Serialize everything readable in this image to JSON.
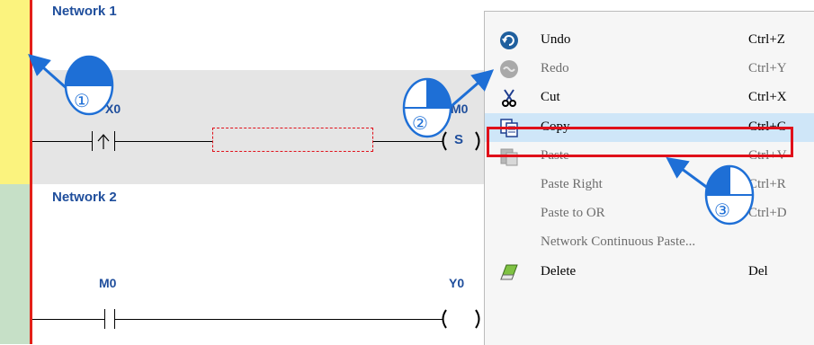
{
  "ladder": {
    "networks": [
      {
        "label": "Network 1",
        "contact": "X0",
        "coil": "M0",
        "coil_type": "S"
      },
      {
        "label": "Network 2",
        "contact": "M0",
        "coil": "Y0",
        "coil_type": ""
      }
    ]
  },
  "context_menu": {
    "items": [
      {
        "label": "Undo",
        "shortcut": "Ctrl+Z",
        "icon": "undo-icon",
        "enabled": true
      },
      {
        "label": "Redo",
        "shortcut": "Ctrl+Y",
        "icon": "redo-icon",
        "enabled": false
      },
      {
        "label": "Cut",
        "shortcut": "Ctrl+X",
        "icon": "scissors-icon",
        "enabled": true
      },
      {
        "label": "Copy",
        "shortcut": "Ctrl+C",
        "icon": "copy-icon",
        "enabled": true,
        "highlighted": true
      },
      {
        "label": "Paste",
        "shortcut": "Ctrl+V",
        "icon": "paste-icon",
        "enabled": false
      },
      {
        "label": "Paste Right",
        "shortcut": "Ctrl+R",
        "icon": "",
        "enabled": false
      },
      {
        "label": "Paste to OR",
        "shortcut": "Ctrl+D",
        "icon": "",
        "enabled": false
      },
      {
        "label": "Network Continuous Paste...",
        "shortcut": "",
        "icon": "",
        "enabled": false
      },
      {
        "label": "Delete",
        "shortcut": "Del",
        "icon": "eraser-icon",
        "enabled": true
      }
    ]
  },
  "steps": [
    {
      "number": "①"
    },
    {
      "number": "②"
    },
    {
      "number": "③"
    }
  ],
  "colors": {
    "rail": "#e32018",
    "network1_strip": "#fbf37e",
    "network2_strip": "#c6e0c7",
    "selected_band": "#e5e5e5",
    "label_blue": "#1f4e9c",
    "highlight_border": "#e0101a",
    "arrow_blue": "#1e6fd6"
  }
}
